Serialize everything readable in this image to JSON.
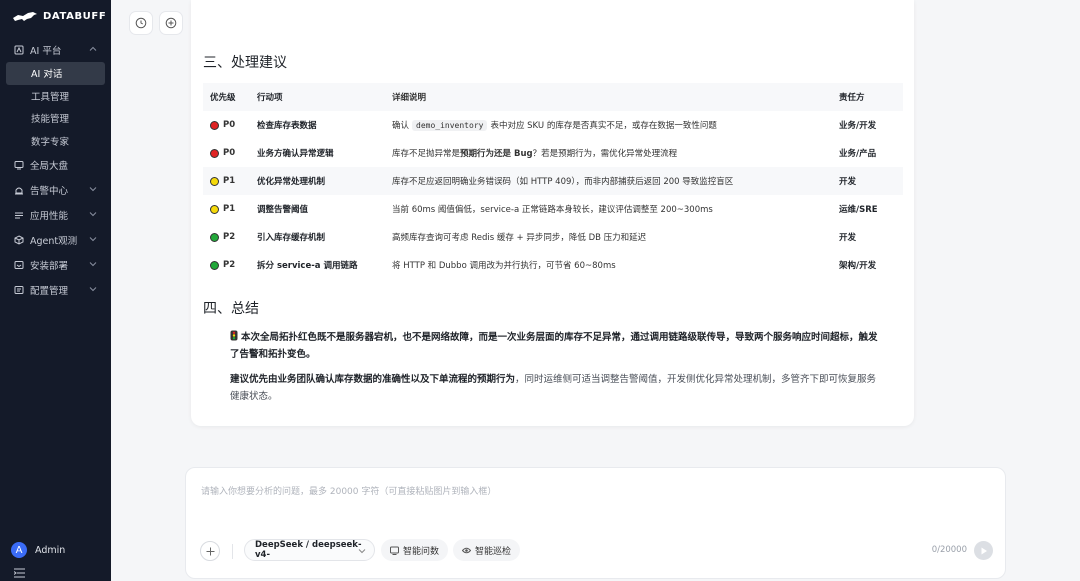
{
  "brand": {
    "name": "DATABUFF"
  },
  "sidebar": {
    "items": [
      {
        "label": "AI 平台",
        "icon": "ai-icon",
        "expanded": true,
        "children": [
          {
            "label": "AI 对话",
            "active": true
          },
          {
            "label": "工具管理"
          },
          {
            "label": "技能管理"
          },
          {
            "label": "数字专家"
          }
        ]
      },
      {
        "label": "全局大盘",
        "icon": "dashboard-icon"
      },
      {
        "label": "告警中心",
        "icon": "alarm-icon",
        "expandable": true
      },
      {
        "label": "应用性能",
        "icon": "app-performance-icon",
        "expandable": true
      },
      {
        "label": "Agent观测",
        "icon": "cube-icon",
        "expandable": true
      },
      {
        "label": "安装部署",
        "icon": "install-icon",
        "expandable": true
      },
      {
        "label": "配置管理",
        "icon": "config-icon",
        "expandable": true
      }
    ],
    "user": {
      "initial": "A",
      "name": "Admin"
    }
  },
  "toolbar": {
    "history_icon": "clock-icon",
    "new_icon": "plus-circle-icon"
  },
  "section3": {
    "title": "三、处理建议",
    "columns": [
      "优先级",
      "行动项",
      "详细说明",
      "责任方"
    ],
    "rows": [
      {
        "dot": "#e02424",
        "priority": "P0",
        "action": "检查库存表数据",
        "pre": "确认",
        "code": "demo_inventory",
        "post": "表中对应 SKU 的库存是否真实不足，或存在数据一致性问题",
        "owner": "业务/开发"
      },
      {
        "dot": "#e02424",
        "priority": "P0",
        "action": "业务方确认异常逻辑",
        "pre": "库存不足抛异常是",
        "bold": "预期行为还是 Bug",
        "post": "？若是预期行为，需优化异常处理流程",
        "owner": "业务/产品"
      },
      {
        "dot": "#f5d90a",
        "priority": "P1",
        "action": "优化异常处理机制",
        "detail": "库存不足应返回明确业务错误码（如 HTTP 409），而非内部捕获后返回 200 导致监控盲区",
        "owner": "开发"
      },
      {
        "dot": "#f5d90a",
        "priority": "P1",
        "action": "调整告警阈值",
        "detail": "当前 60ms 阈值偏低，service-a 正常链路本身较长，建议评估调整至 200~300ms",
        "owner": "运维/SRE"
      },
      {
        "dot": "#22a83a",
        "priority": "P2",
        "action": "引入库存缓存机制",
        "detail": "高频库存查询可考虑 Redis 缓存 + 异步同步，降低 DB 压力和延迟",
        "owner": "开发"
      },
      {
        "dot": "#22a83a",
        "priority": "P2",
        "action": "拆分 service-a 调用链路",
        "detail": "将 HTTP 和 Dubbo 调用改为并行执行，可节省 60~80ms",
        "owner": "架构/开发"
      }
    ]
  },
  "section4": {
    "title": "四、总结",
    "p1": "本次全局拓扑红色既不是服务器宕机，也不是网络故障，而是一次业务层面的库存不足异常，通过调用链路级联传导，导致两个服务响应时间超标，触发了告警和拓扑变色。",
    "p2_bold": "建议优先由业务团队确认库存数据的准确性以及下单流程的预期行为",
    "p2_rest": "，同时运维侧可适当调整告警阈值，开发侧优化异常处理机制，多管齐下即可恢复服务健康状态。"
  },
  "composer": {
    "placeholder": "请输入你想要分析的问题，最多 20000 字符（可直接粘贴图片到输入框）",
    "model": "DeepSeek / deepseek-v4-",
    "pill1": "智能问数",
    "pill2": "智能巡检",
    "counter": "0/20000"
  }
}
